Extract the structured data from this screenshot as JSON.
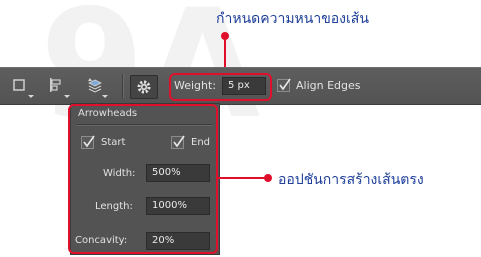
{
  "watermark": "9A",
  "annotations": {
    "top_label": "กำหนดความหนาของเส้น",
    "side_label": "ออปชันการสร้างเส้นตรง",
    "accent_color": "#e0102c",
    "text_color": "#1e3f9a"
  },
  "toolbar": {
    "icons": [
      "path-operations-icon",
      "path-alignment-icon",
      "path-arrangement-icon",
      "gear-icon"
    ],
    "weight_label": "Weight:",
    "weight_value": "5 px",
    "align_edges_label": "Align Edges",
    "align_edges_checked": true
  },
  "arrowheads": {
    "title": "Arrowheads",
    "start_label": "Start",
    "start_checked": true,
    "end_label": "End",
    "end_checked": true,
    "width_label": "Width:",
    "width_value": "500%",
    "length_label": "Length:",
    "length_value": "1000%",
    "concavity_label": "Concavity:",
    "concavity_value": "20%"
  }
}
